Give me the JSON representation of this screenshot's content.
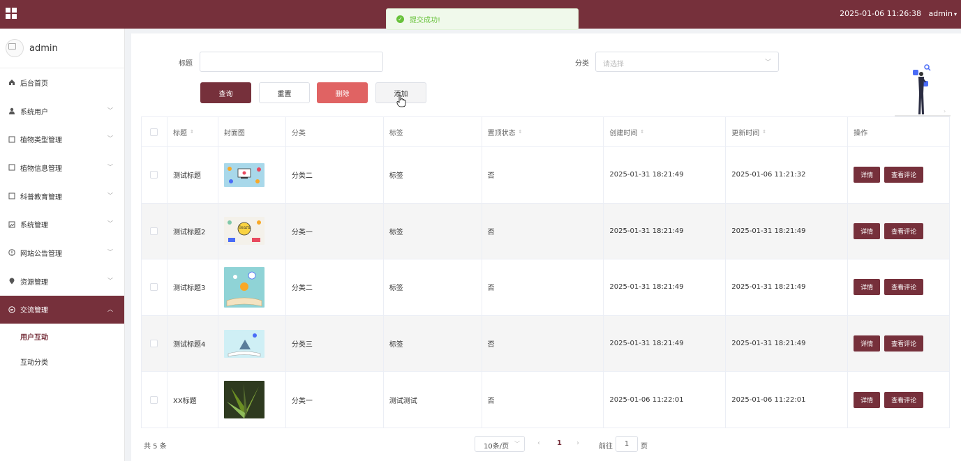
{
  "header": {
    "datetime": "2025-01-06 11:26:38",
    "user": "admin"
  },
  "toast": {
    "message": "提交成功!"
  },
  "sidebar": {
    "username": "admin",
    "items": [
      {
        "label": "后台首页",
        "icon": "home-icon"
      },
      {
        "label": "系统用户",
        "icon": "user-icon"
      },
      {
        "label": "植物类型管理",
        "icon": "document-icon"
      },
      {
        "label": "植物信息管理",
        "icon": "document-icon"
      },
      {
        "label": "科普教育管理",
        "icon": "document-icon"
      },
      {
        "label": "系统管理",
        "icon": "picture-icon"
      },
      {
        "label": "网站公告管理",
        "icon": "info-icon"
      },
      {
        "label": "资源管理",
        "icon": "location-icon"
      },
      {
        "label": "交流管理",
        "icon": "chat-icon"
      }
    ],
    "subitems": [
      {
        "label": "用户互动"
      },
      {
        "label": "互动分类"
      }
    ]
  },
  "filters": {
    "title_label": "标题",
    "category_label": "分类",
    "category_placeholder": "请选择"
  },
  "toolbar": {
    "query": "查询",
    "reset": "重置",
    "delete": "删除",
    "add": "添加"
  },
  "table": {
    "headers": [
      "标题",
      "封面图",
      "分类",
      "标签",
      "置顶状态",
      "创建时间",
      "更新时间",
      "操作"
    ],
    "rows": [
      {
        "title": "测试标题",
        "category": "分类二",
        "tag": "标签",
        "top": "否",
        "created": "2025-01-31 18:21:49",
        "updated": "2025-01-06 11:21:32"
      },
      {
        "title": "测试标题2",
        "category": "分类一",
        "tag": "标签",
        "top": "否",
        "created": "2025-01-31 18:21:49",
        "updated": "2025-01-31 18:21:49"
      },
      {
        "title": "测试标题3",
        "category": "分类二",
        "tag": "标签",
        "top": "否",
        "created": "2025-01-31 18:21:49",
        "updated": "2025-01-31 18:21:49"
      },
      {
        "title": "测试标题4",
        "category": "分类三",
        "tag": "标签",
        "top": "否",
        "created": "2025-01-31 18:21:49",
        "updated": "2025-01-31 18:21:49"
      },
      {
        "title": "XX标题",
        "category": "分类一",
        "tag": "测试测试",
        "top": "否",
        "created": "2025-01-06 11:22:01",
        "updated": "2025-01-06 11:22:01"
      }
    ],
    "detail_label": "详情",
    "comments_label": "查看评论"
  },
  "pagination": {
    "total": "共 5 条",
    "page_size": "10条/页",
    "current": "1",
    "goto_label": "前往",
    "goto_value": "1",
    "page_word": "页"
  },
  "colors": {
    "brand": "#76303b",
    "danger": "#e06363",
    "success": "#67c23a"
  }
}
